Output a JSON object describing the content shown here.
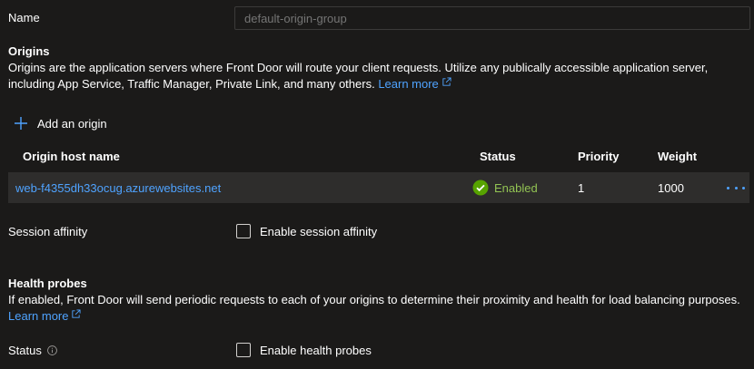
{
  "name_field": {
    "label": "Name",
    "placeholder": "default-origin-group"
  },
  "origins": {
    "title": "Origins",
    "description": "Origins are the application servers where Front Door will route your client requests. Utilize any publically accessible application server, including App Service, Traffic Manager, Private Link, and many others. ",
    "learn_more": "Learn more",
    "add_label": "Add an origin",
    "table": {
      "columns": [
        "Origin host name",
        "Status",
        "Priority",
        "Weight"
      ],
      "rows": [
        {
          "host": "web-f4355dh33ocug.azurewebsites.net",
          "status": "Enabled",
          "priority": "1",
          "weight": "1000"
        }
      ]
    }
  },
  "session_affinity": {
    "label": "Session affinity",
    "checkbox_label": "Enable session affinity"
  },
  "health_probes": {
    "title": "Health probes",
    "description": "If enabled, Front Door will send periodic requests to each of your origins to determine their proximity and health for load balancing purposes. ",
    "learn_more": "Learn more",
    "status_label": "Status",
    "checkbox_label": "Enable health probes"
  },
  "colors": {
    "background": "#1b1a19",
    "link": "#4fa3ff",
    "enabled": "#92c353",
    "row_background": "#2e2d2c"
  }
}
